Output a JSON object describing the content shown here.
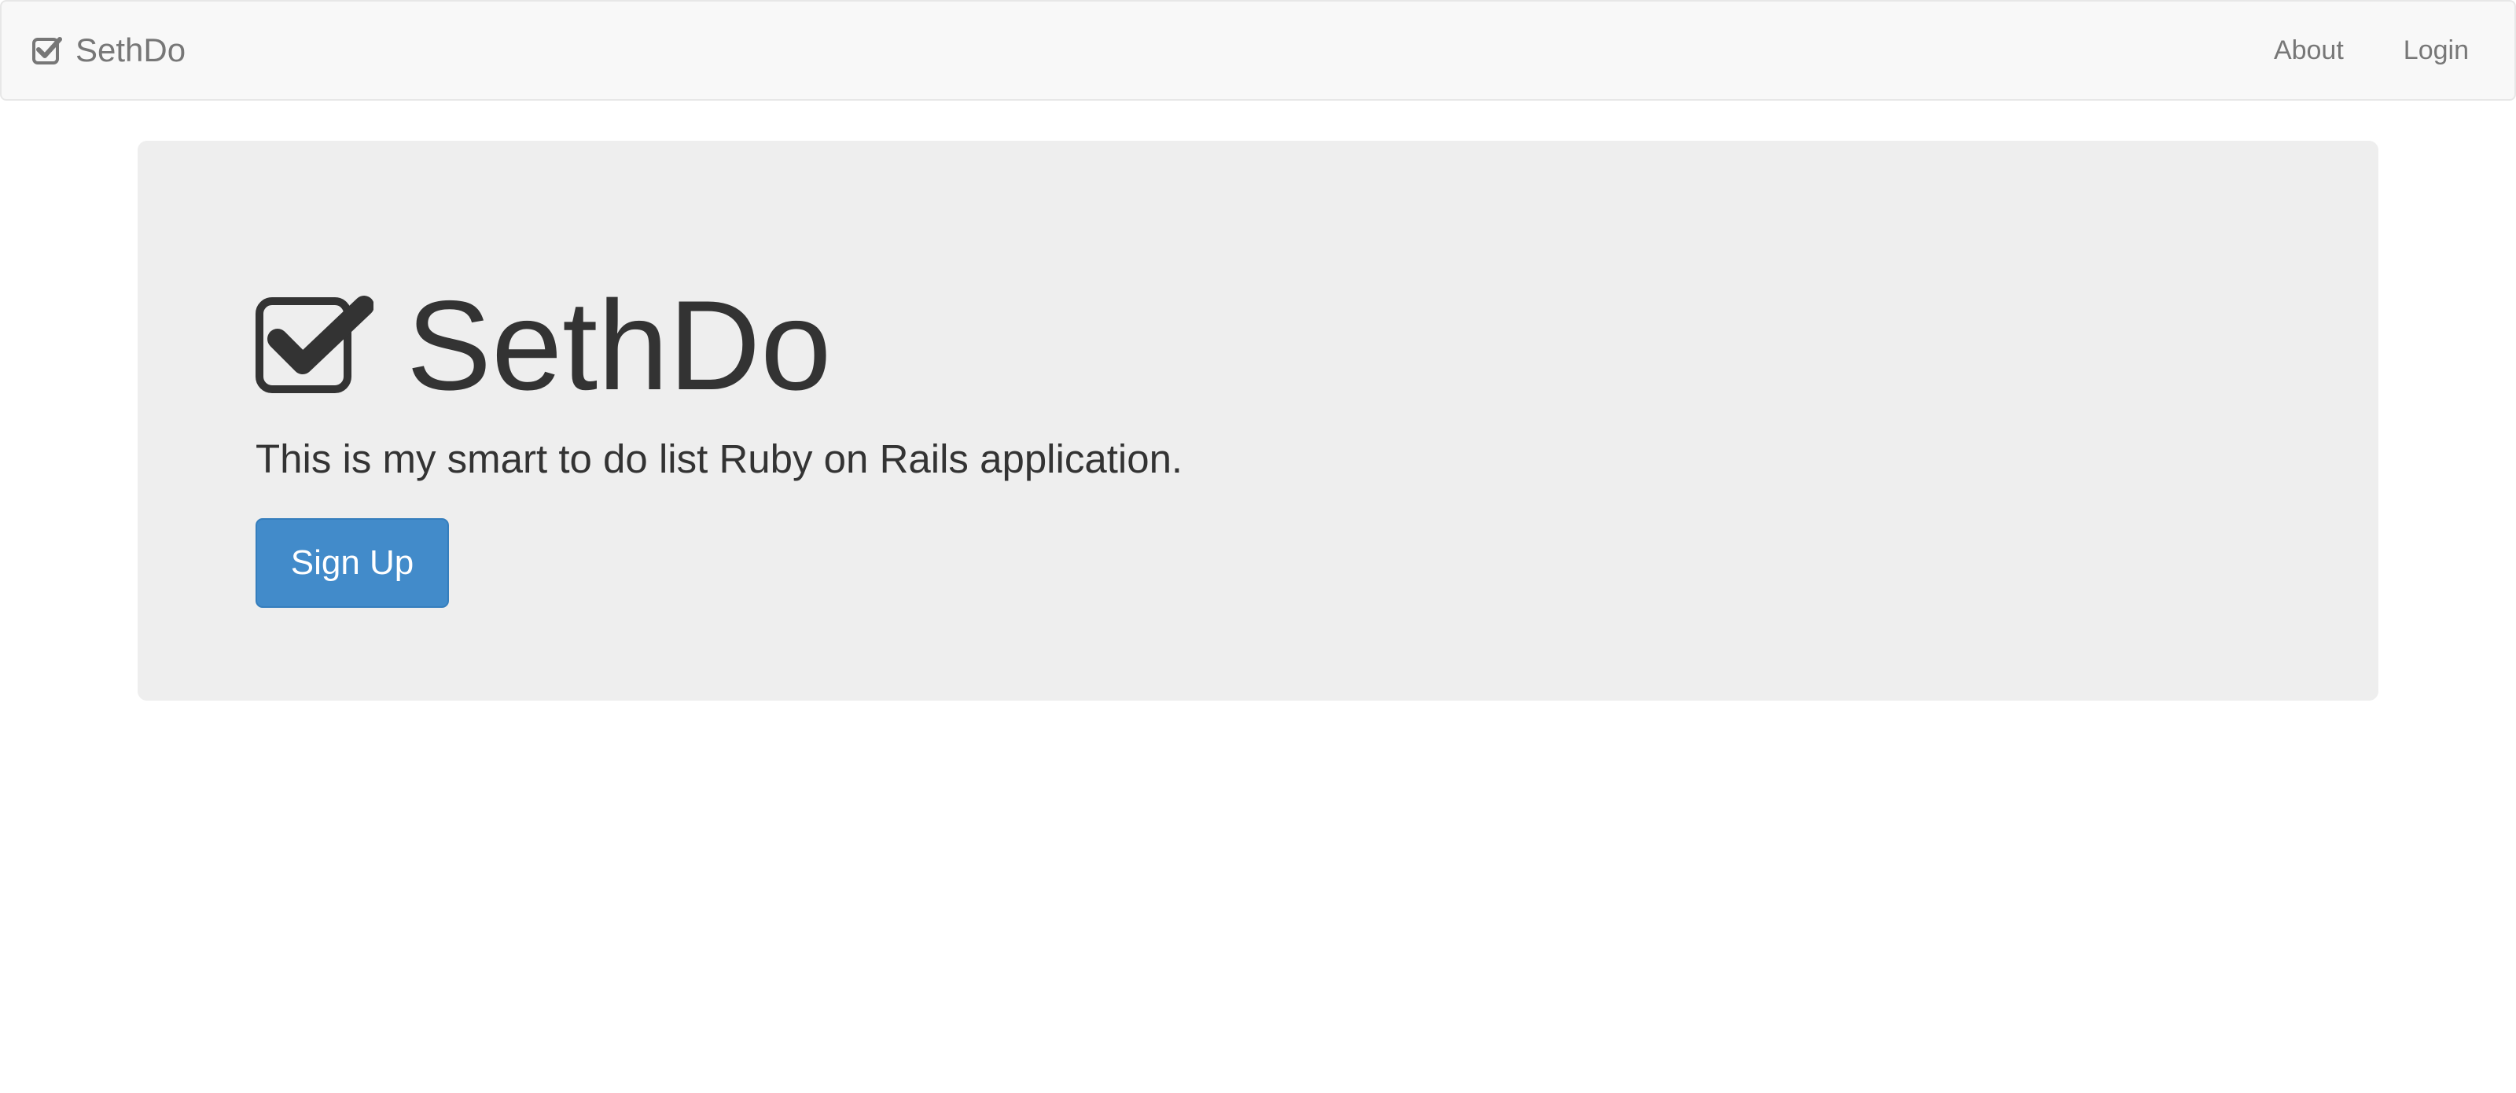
{
  "navbar": {
    "brand_icon": "check-square-icon",
    "brand_text": "SethDo",
    "links": [
      {
        "label": "About"
      },
      {
        "label": "Login"
      }
    ]
  },
  "jumbotron": {
    "heading_icon": "check-square-icon",
    "title": "SethDo",
    "lead": "This is my smart to do list Ruby on Rails application.",
    "signup_label": "Sign Up"
  },
  "colors": {
    "navbar_bg": "#f8f8f8",
    "jumbotron_bg": "#eeeeee",
    "primary": "#428bca",
    "text": "#333333",
    "nav_text": "#777777"
  }
}
